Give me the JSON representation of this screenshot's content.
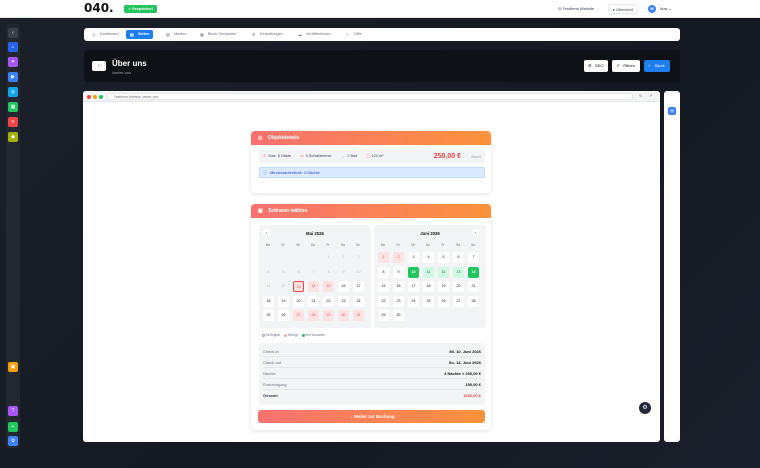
{
  "topbar": {
    "logo": "040.",
    "saved_badge": "Gespeichert",
    "website": "Testfirma Website",
    "overview": "Übersicht",
    "user_initial": "M",
    "user_name": "Max"
  },
  "colors": {
    "accent": "#1d7ef0",
    "brand_gradient_start": "#f87171",
    "brand_gradient_end": "#fb923c",
    "success": "#22c55e"
  },
  "rail": {
    "items": [
      {
        "icon": "chevron-left-icon",
        "glyph": "‹",
        "color": "#3a3f4a"
      },
      {
        "icon": "home-icon",
        "glyph": "⌂",
        "color": "#2563eb"
      },
      {
        "icon": "sparkle-icon",
        "glyph": "✦",
        "color": "#a855f7"
      },
      {
        "icon": "video-icon",
        "glyph": "▶",
        "color": "#3b82f6"
      },
      {
        "icon": "globe-icon",
        "glyph": "◎",
        "color": "#0ea5e9"
      },
      {
        "icon": "calendar-icon",
        "glyph": "▦",
        "color": "#22c55e"
      },
      {
        "icon": "doc-icon",
        "glyph": "≡",
        "color": "#ef4444"
      },
      {
        "icon": "tag-icon",
        "glyph": "◆",
        "color": "#a3b30a"
      },
      {
        "icon": "box-icon",
        "glyph": "▣",
        "color": "#f59e0b"
      },
      {
        "icon": "help-icon",
        "glyph": "?",
        "color": "#a855f7"
      },
      {
        "icon": "plus-icon",
        "glyph": "+",
        "color": "#22c55e"
      },
      {
        "icon": "settings-icon",
        "glyph": "⚙",
        "color": "#3b82f6"
      }
    ]
  },
  "tabs": [
    {
      "label": "Dashboard",
      "icon": "◷",
      "active": false
    },
    {
      "label": "Seiten",
      "icon": "▤",
      "active": true
    },
    {
      "label": "Medien",
      "icon": "▧",
      "active": false
    },
    {
      "label": "Block-Templates",
      "icon": "▦",
      "active": false
    },
    {
      "label": "Einstellungen",
      "icon": "⚙",
      "active": false
    },
    {
      "label": "Veröffentlichen",
      "icon": "☁",
      "active": false
    },
    {
      "label": "Hilfe",
      "icon": "?",
      "active": false
    }
  ],
  "header": {
    "back": "‹",
    "title": "Über uns",
    "slug": "/ueber-uns",
    "seo": "SEO",
    "open": "Öffnen",
    "block": "Block"
  },
  "browser": {
    "url": "Testfirma Website /ueber-uns"
  },
  "details": {
    "title": "Objektdetails",
    "guests": "Max. 8 Gäste",
    "bedrooms": "3 Schlafzimmer",
    "baths": "2 Bad",
    "area": "120 m²",
    "price": "250,00 €",
    "price_unit": "/Nacht",
    "min_stay": "Mindestaufenthalt: 3 Nächte"
  },
  "booking": {
    "title": "Zeitraum wählen",
    "weekdays": [
      "Mo",
      "Di",
      "Mi",
      "Do",
      "Fr",
      "Sa",
      "So"
    ],
    "may": {
      "title": "Mai 2026",
      "days": [
        {
          "d": "",
          "s": ""
        },
        {
          "d": "",
          "s": ""
        },
        {
          "d": "",
          "s": ""
        },
        {
          "d": "",
          "s": ""
        },
        {
          "d": "1",
          "s": "past"
        },
        {
          "d": "2",
          "s": "past"
        },
        {
          "d": "3",
          "s": "past"
        },
        {
          "d": "4",
          "s": "past"
        },
        {
          "d": "5",
          "s": "past"
        },
        {
          "d": "6",
          "s": "past"
        },
        {
          "d": "7",
          "s": "past"
        },
        {
          "d": "8",
          "s": "past"
        },
        {
          "d": "9",
          "s": "past"
        },
        {
          "d": "10",
          "s": "past"
        },
        {
          "d": "11",
          "s": "past"
        },
        {
          "d": "12",
          "s": "past"
        },
        {
          "d": "13",
          "s": "today"
        },
        {
          "d": "14",
          "s": "booked"
        },
        {
          "d": "15",
          "s": "booked"
        },
        {
          "d": "16",
          "s": ""
        },
        {
          "d": "17",
          "s": ""
        },
        {
          "d": "18",
          "s": ""
        },
        {
          "d": "19",
          "s": ""
        },
        {
          "d": "20",
          "s": ""
        },
        {
          "d": "21",
          "s": ""
        },
        {
          "d": "22",
          "s": ""
        },
        {
          "d": "23",
          "s": ""
        },
        {
          "d": "24",
          "s": ""
        },
        {
          "d": "25",
          "s": ""
        },
        {
          "d": "26",
          "s": ""
        },
        {
          "d": "27",
          "s": "booked"
        },
        {
          "d": "28",
          "s": "booked"
        },
        {
          "d": "29",
          "s": "booked"
        },
        {
          "d": "30",
          "s": "booked"
        },
        {
          "d": "31",
          "s": "booked"
        }
      ]
    },
    "june": {
      "title": "Juni 2026",
      "days": [
        {
          "d": "1",
          "s": "booked"
        },
        {
          "d": "2",
          "s": "booked"
        },
        {
          "d": "3",
          "s": ""
        },
        {
          "d": "4",
          "s": ""
        },
        {
          "d": "5",
          "s": ""
        },
        {
          "d": "6",
          "s": ""
        },
        {
          "d": "7",
          "s": ""
        },
        {
          "d": "8",
          "s": ""
        },
        {
          "d": "9",
          "s": ""
        },
        {
          "d": "10",
          "s": "sel"
        },
        {
          "d": "11",
          "s": "range"
        },
        {
          "d": "12",
          "s": "range"
        },
        {
          "d": "13",
          "s": "range"
        },
        {
          "d": "14",
          "s": "sel"
        },
        {
          "d": "15",
          "s": ""
        },
        {
          "d": "16",
          "s": ""
        },
        {
          "d": "17",
          "s": ""
        },
        {
          "d": "18",
          "s": ""
        },
        {
          "d": "19",
          "s": ""
        },
        {
          "d": "20",
          "s": ""
        },
        {
          "d": "21",
          "s": ""
        },
        {
          "d": "22",
          "s": ""
        },
        {
          "d": "23",
          "s": ""
        },
        {
          "d": "24",
          "s": ""
        },
        {
          "d": "25",
          "s": ""
        },
        {
          "d": "26",
          "s": ""
        },
        {
          "d": "27",
          "s": ""
        },
        {
          "d": "28",
          "s": ""
        },
        {
          "d": "29",
          "s": ""
        },
        {
          "d": "30",
          "s": ""
        }
      ]
    },
    "legend": {
      "available": "Verfügbar",
      "booked": "Belegt",
      "selected": "Ihre Auswahl"
    },
    "summary": [
      {
        "label": "Check-in",
        "value": "Mi. 10. Juni 2026"
      },
      {
        "label": "Check-out",
        "value": "So. 14. Juni 2026"
      },
      {
        "label": "Nächte",
        "value": "4 Nächte × 250,00 €"
      },
      {
        "label": "Endreinigung",
        "value": "150,00 €"
      },
      {
        "label": "Gesamt",
        "value": "1150,00 €"
      }
    ],
    "cta": "Weiter zur Buchung"
  }
}
